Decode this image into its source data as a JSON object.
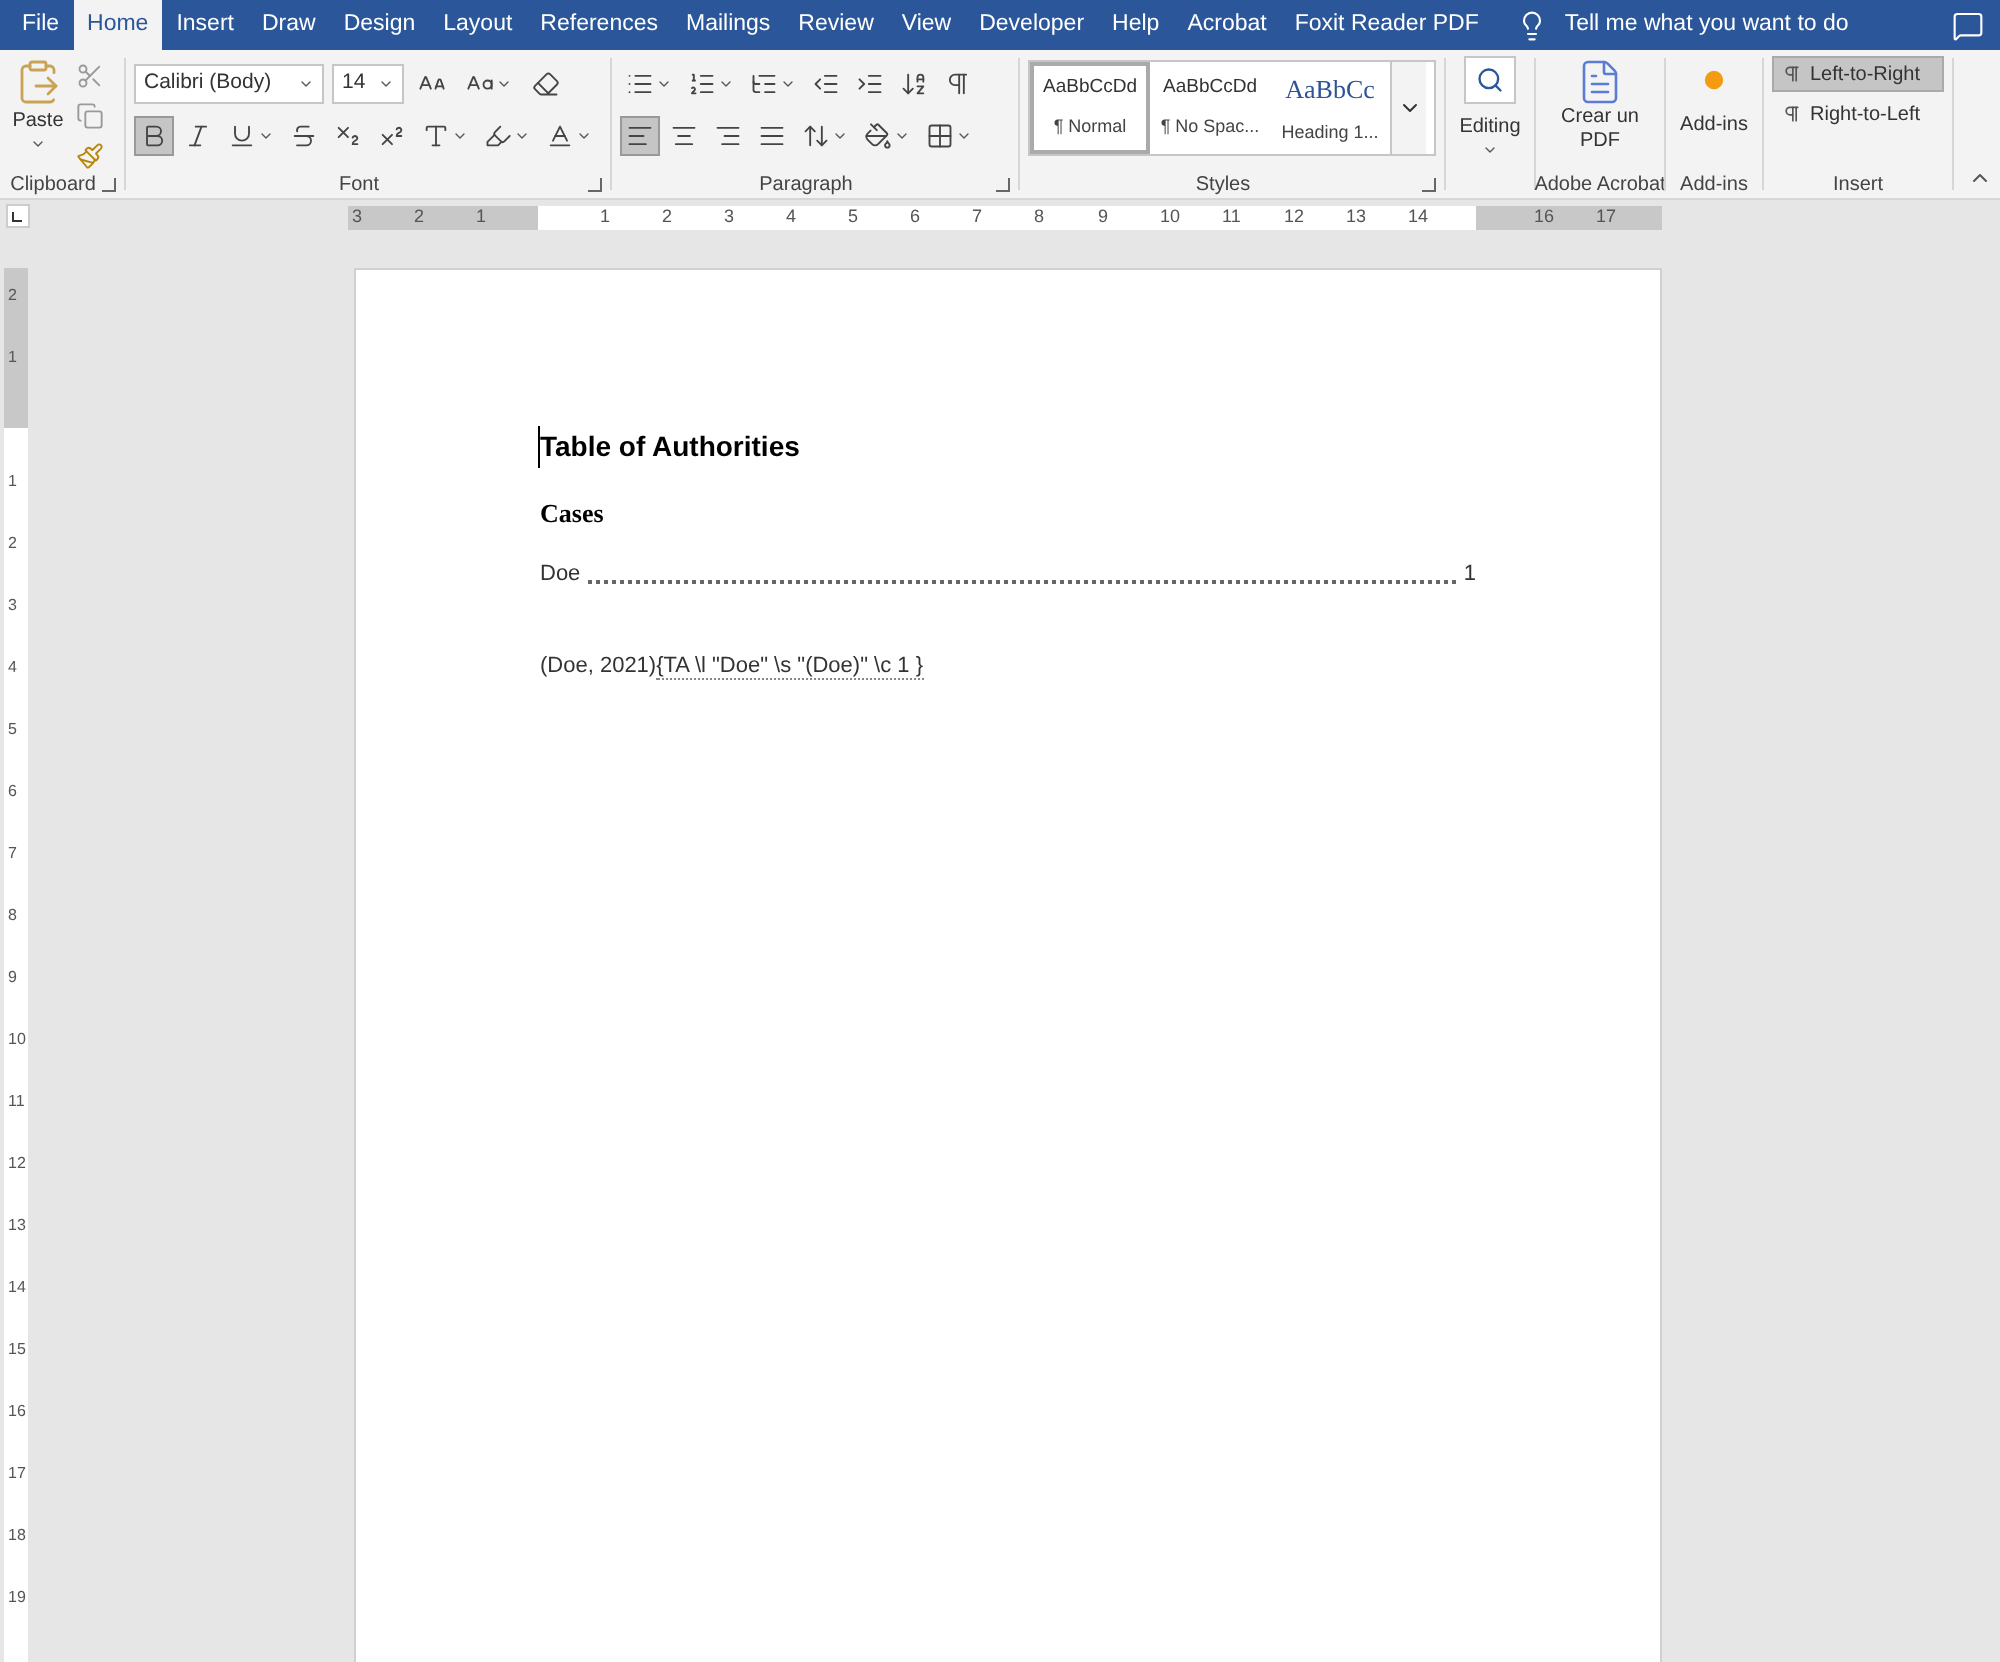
{
  "menu_tabs": [
    {
      "label": "File",
      "selected": false
    },
    {
      "label": "Home",
      "selected": true
    },
    {
      "label": "Insert",
      "selected": false
    },
    {
      "label": "Draw",
      "selected": false
    },
    {
      "label": "Design",
      "selected": false
    },
    {
      "label": "Layout",
      "selected": false
    },
    {
      "label": "References",
      "selected": false
    },
    {
      "label": "Mailings",
      "selected": false
    },
    {
      "label": "Review",
      "selected": false
    },
    {
      "label": "View",
      "selected": false
    },
    {
      "label": "Developer",
      "selected": false
    },
    {
      "label": "Help",
      "selected": false
    },
    {
      "label": "Acrobat",
      "selected": false
    },
    {
      "label": "Foxit Reader PDF",
      "selected": false
    }
  ],
  "tell_me": "Tell me what you want to do",
  "clipboard": {
    "paste": "Paste",
    "label": "Clipboard"
  },
  "font": {
    "name": "Calibri (Body)",
    "size": "14",
    "bold": true,
    "italic": false,
    "underline": false,
    "label": "Font"
  },
  "paragraph": {
    "align_left": true,
    "show_marks": false,
    "label": "Paragraph"
  },
  "styles": {
    "items": [
      {
        "preview": "AaBbCcDd",
        "name": "¶ Normal",
        "selected": true,
        "kind": "body"
      },
      {
        "preview": "AaBbCcDd",
        "name": "¶ No Spac...",
        "selected": false,
        "kind": "body"
      },
      {
        "preview": "AaBbCc",
        "name": "Heading 1...",
        "selected": false,
        "kind": "heading"
      }
    ],
    "label": "Styles"
  },
  "editing": {
    "label": "Editing"
  },
  "acrobat": {
    "button": "Crear un PDF",
    "label": "Adobe Acrobat"
  },
  "addins": {
    "button": "Add-ins",
    "label": "Add-ins"
  },
  "insert": {
    "items": [
      {
        "label": "Left-to-Right",
        "selected": true
      },
      {
        "label": "Right-to-Left",
        "selected": false
      }
    ],
    "label": "Insert"
  },
  "hruler": [
    "3",
    "2",
    "1",
    "1",
    "2",
    "3",
    "4",
    "5",
    "6",
    "7",
    "8",
    "9",
    "10",
    "11",
    "12",
    "13",
    "14",
    "16",
    "17"
  ],
  "vruler": [
    "2",
    "1",
    "1",
    "2",
    "3",
    "4",
    "5",
    "6",
    "7",
    "8",
    "9",
    "10",
    "11",
    "12",
    "13",
    "14",
    "15",
    "16",
    "17",
    "18",
    "19"
  ],
  "document": {
    "title": "Table of Authorities",
    "category": "Cases",
    "entries": [
      {
        "name": "Doe",
        "page": "1"
      }
    ],
    "citation": "(Doe, 2021)",
    "field_code": "{TA \\l \"Doe\" \\s \"(Doe)\" \\c 1 }"
  }
}
